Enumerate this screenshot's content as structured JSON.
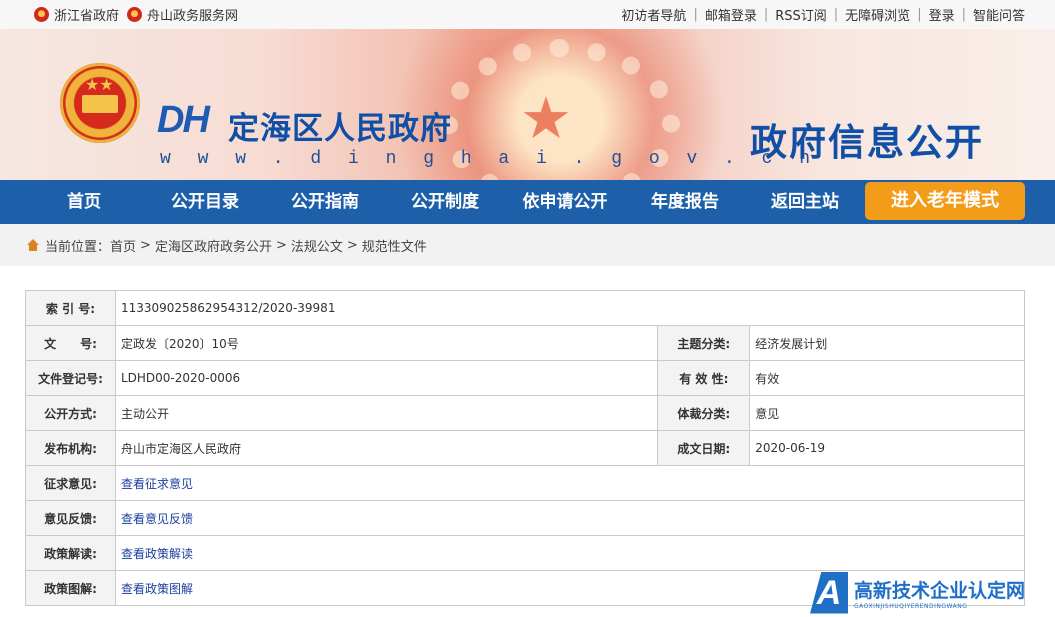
{
  "topbar": {
    "left_links": [
      "浙江省政府",
      "舟山政务服务网"
    ],
    "right_links": [
      "初访者导航",
      "邮箱登录",
      "RSS订阅",
      "无障碍浏览",
      "登录",
      "智能问答"
    ]
  },
  "banner": {
    "logo_mark": "DH",
    "site_title": "定海区人民政府",
    "site_url": "w w w . d i n g h a i . g o v . c n",
    "section_title": "政府信息公开"
  },
  "nav": {
    "items": [
      "首页",
      "公开目录",
      "公开指南",
      "公开制度",
      "依申请公开",
      "年度报告",
      "返回主站"
    ],
    "elder_mode": "进入老年模式"
  },
  "breadcrumb": {
    "prefix": "当前位置：",
    "items": [
      "首页",
      "定海区政府政务公开",
      "法规公文",
      "规范性文件"
    ]
  },
  "meta": {
    "index_label": "索 引 号:",
    "index_value": "113309025862954312/2020-39981",
    "doc_no_label": "文　　号:",
    "doc_no_value": "定政发〔2020〕10号",
    "topic_label": "主题分类:",
    "topic_value": "经济发展计划",
    "reg_label": "文件登记号:",
    "reg_value": "LDHD00-2020-0006",
    "validity_label": "有 效 性:",
    "validity_value": "有效",
    "open_label": "公开方式:",
    "open_value": "主动公开",
    "genre_label": "体裁分类:",
    "genre_value": "意见",
    "issuer_label": "发布机构:",
    "issuer_value": "舟山市定海区人民政府",
    "date_label": "成文日期:",
    "date_value": "2020-06-19",
    "consult_label": "征求意见:",
    "consult_link": "查看征求意见",
    "feedback_label": "意见反馈:",
    "feedback_link": "查看意见反馈",
    "interp_label": "政策解读:",
    "interp_link": "查看政策解读",
    "graphic_label": "政策图解:",
    "graphic_link": "查看政策图解"
  },
  "watermark": {
    "logo": "A",
    "title": "高新技术企业认定网",
    "subtitle": "GAOXINJISHUQIYERENDINGWANG"
  },
  "colors": {
    "nav_bg": "#1d5fa9",
    "elder_button": "#f39c1a",
    "title_blue": "#0f4fa6",
    "link_blue": "#1b3f9c"
  }
}
